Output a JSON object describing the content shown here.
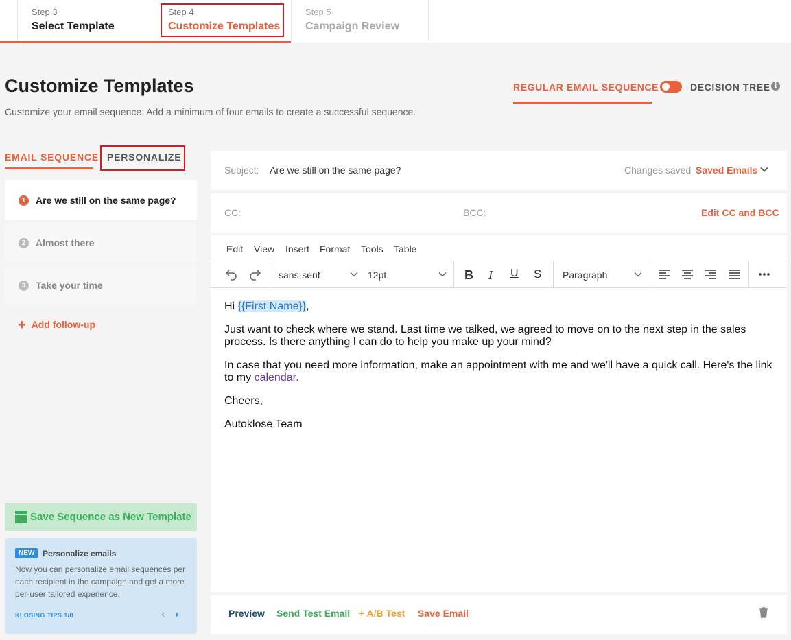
{
  "stepper": {
    "steps": [
      {
        "num": "Step 3",
        "title": "Select Template"
      },
      {
        "num": "Step 4",
        "title": "Customize Templates"
      },
      {
        "num": "Step 5",
        "title": "Campaign Review"
      }
    ]
  },
  "header": {
    "title": "Customize Templates",
    "subtitle": "Customize your email sequence. Add a minimum of four emails to create a successful sequence.",
    "mode_regular": "REGULAR EMAIL SEQUENCE",
    "mode_tree": "DECISION TREE"
  },
  "left_tabs": {
    "sequence": "EMAIL SEQUENCE",
    "personalize": "PERSONALIZE"
  },
  "sequence": [
    {
      "n": "1",
      "label": "Are we still on the same page?"
    },
    {
      "n": "2",
      "label": "Almost there"
    },
    {
      "n": "3",
      "label": "Take your time"
    }
  ],
  "add_followup": "Add follow-up",
  "save_template": "Save Sequence as New Template",
  "tips": {
    "badge": "NEW",
    "title": "Personalize emails",
    "body": "Now you can personalize email sequences per each recipient in the campaign and get a more per-user tailored experience.",
    "counter": "KLOSING TIPS 1/8"
  },
  "subject": {
    "label": "Subject:",
    "value": "Are we still on the same page?",
    "status": "Changes saved",
    "saved_emails": "Saved Emails"
  },
  "cc": {
    "cc_label": "CC:",
    "bcc_label": "BCC:",
    "edit": "Edit CC and BCC"
  },
  "menubar": [
    "Edit",
    "View",
    "Insert",
    "Format",
    "Tools",
    "Table"
  ],
  "toolbar": {
    "font": "sans-serif",
    "size": "12pt",
    "block": "Paragraph"
  },
  "body": {
    "greeting_prefix": "Hi ",
    "first_name_var": "{{First Name}}",
    "greeting_suffix": ",",
    "p1": "Just want to check where we stand. Last time we talked, we agreed to move on to the next step in the sales process. Is there anything I can do to help you make up your mind?",
    "p2_prefix": "In case that you need more information, make an appointment with me and we'll have a quick call. Here's the link to my ",
    "p2_link": "calendar",
    "p2_suffix": ".",
    "p3": "Cheers,",
    "p4": "Autoklose Team"
  },
  "footer": {
    "preview": "Preview",
    "send_test": "Send Test Email",
    "ab_test": "+ A/B Test",
    "save": "Save Email"
  },
  "colors": {
    "accent": "#e8603c",
    "green": "#3cae5e",
    "blue": "#2f8ee0",
    "orange_ab": "#f0a030",
    "navy": "#1f4e79"
  }
}
